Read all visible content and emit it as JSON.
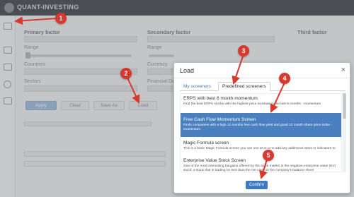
{
  "app": {
    "brand": "QUANT-INVESTING"
  },
  "background": {
    "primary_factor": "Primary factor",
    "secondary_factor": "Secondary factor",
    "third_factor": "Third factor",
    "range_1": "Range",
    "range_2": "Range",
    "countries": "Countries",
    "currency": "Currency",
    "sectors": "Sectors",
    "financial_data": "Financial Data",
    "btn_apply": "Apply",
    "btn_clear": "Clear",
    "btn_save": "Save As",
    "btn_load": "Load"
  },
  "modal": {
    "title": "Load",
    "close": "×",
    "tabs": [
      {
        "label": "My screeners"
      },
      {
        "label": "Predefined screeners"
      }
    ],
    "items": [
      {
        "name": "ERPS with best 6 month momentum",
        "desc": "Find the best ERPS stocks with the highest price increase in the last 6 months - momentum"
      },
      {
        "name": "Free Cash Flow Momentum Screen",
        "desc": "Finds companies with a high 12 months free cash flow yield and good 12 month share price index - momentum"
      },
      {
        "name": "Magic Formula screen",
        "desc": "This is a basic Magic Formula screen you can use as is or to add any additional ratios or indicators to"
      },
      {
        "name": "Enterprise Value Stock Screen",
        "desc": "One of the most interesting bargains offered by the stock market is the negative enterprise value (EV) stock: a stock that is trading for less than the net cash on the company's balance sheet"
      }
    ],
    "confirm": "Confirm"
  },
  "steps": [
    "1",
    "2",
    "3",
    "4",
    "5"
  ],
  "colors": {
    "badge": "#d7392e",
    "selected": "#4a80c0",
    "confirm": "#3d7ac0"
  }
}
